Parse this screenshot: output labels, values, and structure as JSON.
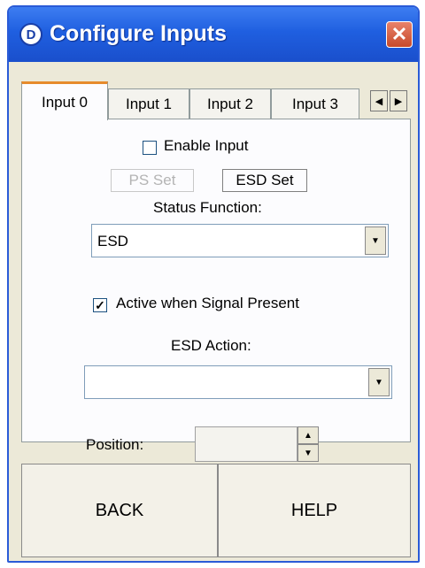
{
  "window": {
    "title": "Configure Inputs",
    "app_icon_glyph": "D",
    "close_glyph": "✕"
  },
  "tabs": [
    {
      "label": "Input 0",
      "active": true
    },
    {
      "label": "Input 1",
      "active": false
    },
    {
      "label": "Input 2",
      "active": false
    },
    {
      "label": "Input 3",
      "active": false
    }
  ],
  "tab_scroll": {
    "left_glyph": "◀",
    "right_glyph": "▶"
  },
  "form": {
    "enable_input": {
      "label": "Enable Input",
      "checked": false,
      "mark": ""
    },
    "ps_set_label": "PS Set",
    "esd_set_label": "ESD Set",
    "status_function_label": "Status Function:",
    "status_function_value": "ESD",
    "active_when_signal": {
      "label": "Active when Signal Present",
      "checked": true,
      "mark": "✓"
    },
    "esd_action_label": "ESD Action:",
    "esd_action_value": "",
    "position_label": "Position:",
    "position_value": "",
    "dropdown_glyph": "▼",
    "spin_up_glyph": "▲",
    "spin_down_glyph": "▼"
  },
  "buttons": {
    "back": "BACK",
    "help": "HELP"
  }
}
